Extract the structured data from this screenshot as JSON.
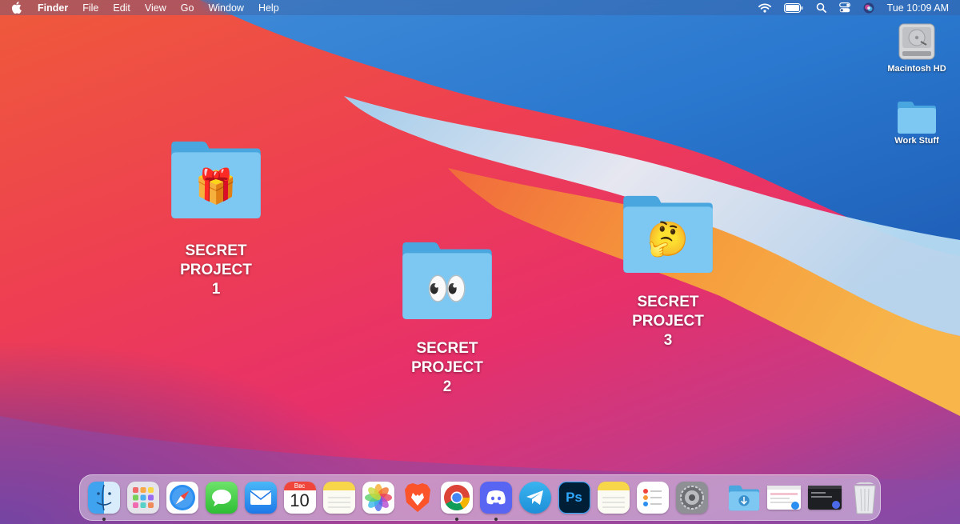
{
  "menubar": {
    "apple_icon": "apple-icon",
    "app_name": "Finder",
    "menus": [
      "File",
      "Edit",
      "View",
      "Go",
      "Window",
      "Help"
    ],
    "status_icons": [
      "wifi-icon",
      "battery-icon",
      "spotlight-search-icon",
      "control-center-icon",
      "siri-icon"
    ],
    "clock": "Tue 10:09 AM"
  },
  "desktop": {
    "right_items": [
      {
        "label": "Macintosh HD",
        "icon": "hard-drive-icon"
      },
      {
        "label": "Work Stuff",
        "icon": "folder-icon"
      }
    ],
    "secret_folders": [
      {
        "line1": "SECRET",
        "line2": "PROJECT",
        "line3": "1",
        "emoji": "🎁",
        "icon": "gift-emoji-icon"
      },
      {
        "line1": "SECRET",
        "line2": "PROJECT",
        "line3": "2",
        "emoji": "👀",
        "icon": "eyes-emoji-icon"
      },
      {
        "line1": "SECRET",
        "line2": "PROJECT",
        "line3": "3",
        "emoji": "🤔",
        "icon": "thinking-face-emoji-icon"
      }
    ]
  },
  "dock": {
    "apps": [
      {
        "name": "Finder",
        "icon": "finder-icon",
        "running": true
      },
      {
        "name": "Launchpad",
        "icon": "launchpad-icon",
        "running": false
      },
      {
        "name": "Safari",
        "icon": "safari-icon",
        "running": false
      },
      {
        "name": "Messages",
        "icon": "messages-icon",
        "running": false
      },
      {
        "name": "Mail",
        "icon": "mail-icon",
        "running": false
      },
      {
        "name": "Calendar",
        "icon": "calendar-icon",
        "running": false,
        "month": "Bвс",
        "day": "10"
      },
      {
        "name": "Notes",
        "icon": "notes-icon",
        "running": false
      },
      {
        "name": "Photos",
        "icon": "photos-icon",
        "running": false
      },
      {
        "name": "Brave",
        "icon": "brave-icon",
        "running": false
      },
      {
        "name": "Chrome",
        "icon": "chrome-icon",
        "running": true
      },
      {
        "name": "Discord",
        "icon": "discord-icon",
        "running": true
      },
      {
        "name": "Telegram",
        "icon": "telegram-icon",
        "running": false
      },
      {
        "name": "Photoshop",
        "icon": "photoshop-icon",
        "running": false,
        "badge_text": "Ps"
      },
      {
        "name": "Notes",
        "icon": "notes-icon",
        "running": false
      },
      {
        "name": "Reminders",
        "icon": "reminders-icon",
        "running": false
      },
      {
        "name": "System Preferences",
        "icon": "system-preferences-icon",
        "running": false
      }
    ],
    "right_items": [
      {
        "name": "Downloads",
        "icon": "downloads-folder-icon"
      },
      {
        "name": "Browser window",
        "icon": "minimized-browser-window-icon"
      },
      {
        "name": "Terminal window",
        "icon": "minimized-terminal-window-icon"
      },
      {
        "name": "Trash",
        "icon": "trash-icon"
      }
    ]
  },
  "colors": {
    "folder_light": "#7cc8f2",
    "folder_dark": "#4aa6de",
    "wallpaper_blue": "#2f86d6",
    "wallpaper_red": "#ee3f52",
    "wallpaper_orange": "#f4a040"
  }
}
